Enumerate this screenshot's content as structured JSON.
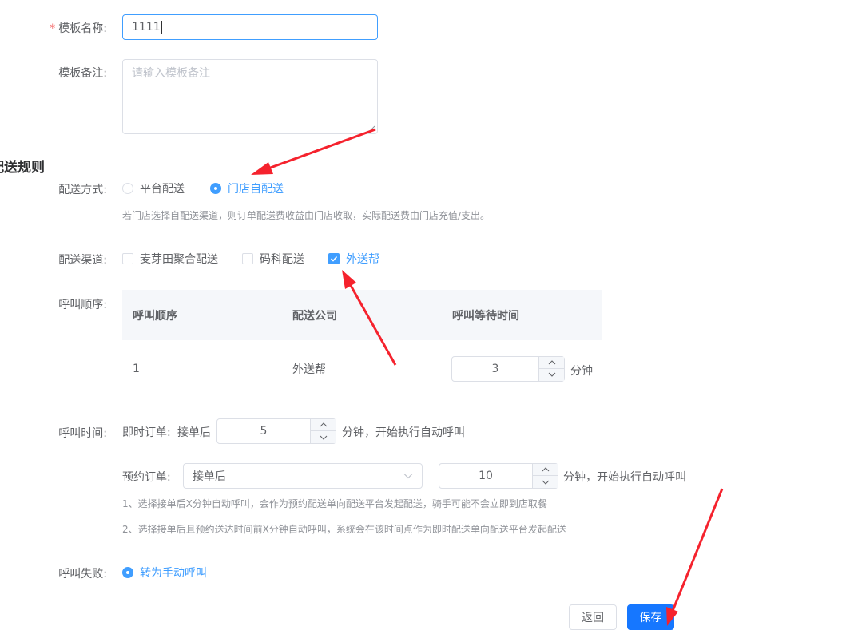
{
  "form": {
    "template_name": {
      "label": "模板名称:",
      "required_mark": "*",
      "value": "1111"
    },
    "template_note": {
      "label": "模板备注:",
      "placeholder": "请输入模板备注"
    }
  },
  "delivery_rules": {
    "section_title": "配送规则",
    "method": {
      "label": "配送方式:",
      "options": [
        "平台配送",
        "门店自配送"
      ],
      "selected": "门店自配送",
      "hint": "若门店选择自配送渠道，则订单配送费收益由门店收取，实际配送费由门店充值/支出。"
    },
    "channels": {
      "label": "配送渠道:",
      "options": [
        "麦芽田聚合配送",
        "码科配送",
        "外送帮"
      ],
      "checked": [
        "外送帮"
      ]
    },
    "call_order": {
      "label": "呼叫顺序:",
      "columns": [
        "呼叫顺序",
        "配送公司",
        "呼叫等待时间"
      ],
      "rows": [
        {
          "order": "1",
          "company": "外送帮",
          "wait": "3",
          "unit": "分钟"
        }
      ]
    },
    "call_time": {
      "label": "呼叫时间:",
      "instant": {
        "prefix": "即时订单:",
        "after": "接单后",
        "value": "5",
        "suffix": "分钟，开始执行自动呼叫"
      },
      "reserve": {
        "prefix": "预约订单:",
        "select_value": "接单后",
        "value": "10",
        "suffix": "分钟，开始执行自动呼叫"
      },
      "notes": [
        "1、选择接单后X分钟自动呼叫，会作为预约配送单向配送平台发起配送，骑手可能不会立即到店取餐",
        "2、选择接单后且预约送达时间前X分钟自动呼叫，系统会在该时间点作为即时配送单向配送平台发起配送"
      ]
    },
    "call_fail": {
      "label": "呼叫失败:",
      "option": "转为手动呼叫"
    }
  },
  "actions": {
    "back_label": "返回",
    "save_label": "保存"
  },
  "colors": {
    "primary": "#1677ff",
    "annotation_arrow": "#f5222d"
  },
  "icons": [
    "chevron-up-icon",
    "chevron-down-icon",
    "check-icon",
    "select-arrow-icon",
    "annotation-arrow-icon"
  ]
}
